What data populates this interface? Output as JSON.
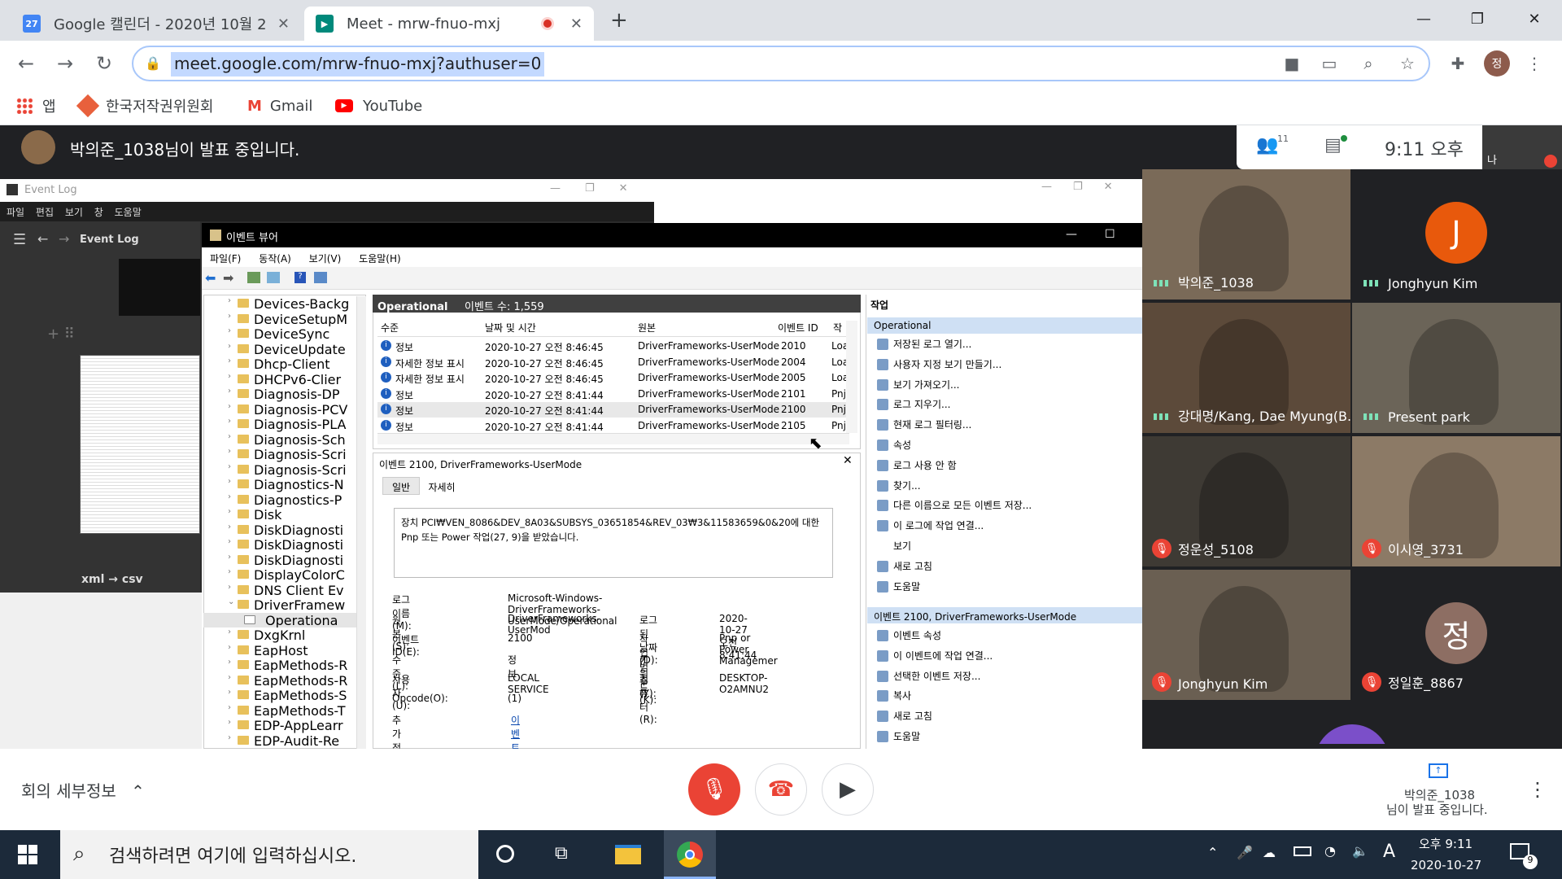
{
  "browser": {
    "tabs": [
      {
        "title": "Google 캘린더 - 2020년 10월 2",
        "icon_text": "27"
      },
      {
        "title": "Meet - mrw-fnuo-mxj"
      }
    ],
    "url": "meet.google.com/mrw-fnuo-mxj?authuser=0",
    "profile_initial": "정",
    "bookmarks": [
      {
        "label": "앱"
      },
      {
        "label": "한국저작권위원회"
      },
      {
        "label": "Gmail"
      },
      {
        "label": "YouTube"
      }
    ]
  },
  "meet": {
    "presenting_text": "박의준_1038님이 발표 중입니다.",
    "participant_count": "11",
    "time": "9:11 오후",
    "self_label": "나",
    "tiles": [
      {
        "name": "박의준_1038",
        "muted": false
      },
      {
        "name": "Jonghyun Kim",
        "muted": false,
        "initial": "J"
      },
      {
        "name": "강대명/Kang, Dae Myung(B...",
        "muted": false
      },
      {
        "name": "Present park",
        "muted": false
      },
      {
        "name": "정운성_5108",
        "muted": true
      },
      {
        "name": "이시영_3731",
        "muted": true
      },
      {
        "name": "Jonghyun Kim",
        "muted": true
      },
      {
        "name": "정일훈_8867",
        "muted": true,
        "initial": "정"
      }
    ],
    "meeting_details": "회의 세부정보",
    "presenter_box": {
      "line1": "박의준_1038",
      "line2": "님이 발표 중입니다."
    }
  },
  "eventlog_app": {
    "title": "Event Log",
    "menu": [
      "파일",
      "편집",
      "보기",
      "창",
      "도움말"
    ],
    "nav_title": "Event Log",
    "caption": "xml → csv"
  },
  "viewer": {
    "title": "이벤트 뷰어",
    "menu": [
      "파일(F)",
      "동작(A)",
      "보기(V)",
      "도움말(H)"
    ],
    "tree": [
      "Devices-Backg",
      "DeviceSetupM",
      "DeviceSync",
      "DeviceUpdate",
      "Dhcp-Client",
      "DHCPv6-Clier",
      "Diagnosis-DP",
      "Diagnosis-PCV",
      "Diagnosis-PLA",
      "Diagnosis-Sch",
      "Diagnosis-Scri",
      "Diagnosis-Scri",
      "Diagnostics-N",
      "Diagnostics-P",
      "Disk",
      "DiskDiagnosti",
      "DiskDiagnosti",
      "DiskDiagnosti",
      "DisplayColorC",
      "DNS Client Ev",
      "DriverFramew",
      "Operationa",
      "DxgKrnl",
      "EapHost",
      "EapMethods-R",
      "EapMethods-R",
      "EapMethods-S",
      "EapMethods-T",
      "EDP-AppLearr",
      "EDP-Audit-Re"
    ],
    "list_header": "Operational",
    "event_count": "이벤트 수: 1,559",
    "columns": [
      "수준",
      "날짜 및 시간",
      "원본",
      "이벤트 ID",
      "작"
    ],
    "rows": [
      {
        "level": "정보",
        "datetime": "2020-10-27 오전 8:46:45",
        "source": "DriverFrameworks-UserMode",
        "id": "2010",
        "task": "Loa"
      },
      {
        "level": "자세한 정보 표시",
        "datetime": "2020-10-27 오전 8:46:45",
        "source": "DriverFrameworks-UserMode",
        "id": "2004",
        "task": "Loa"
      },
      {
        "level": "자세한 정보 표시",
        "datetime": "2020-10-27 오전 8:46:45",
        "source": "DriverFrameworks-UserMode",
        "id": "2005",
        "task": "Loa"
      },
      {
        "level": "정보",
        "datetime": "2020-10-27 오전 8:41:44",
        "source": "DriverFrameworks-UserMode",
        "id": "2101",
        "task": "Pnj"
      },
      {
        "level": "정보",
        "datetime": "2020-10-27 오전 8:41:44",
        "source": "DriverFrameworks-UserMode",
        "id": "2100",
        "task": "Pnj"
      },
      {
        "level": "정보",
        "datetime": "2020-10-27 오전 8:41:44",
        "source": "DriverFrameworks-UserMode",
        "id": "2105",
        "task": "Pnj"
      }
    ],
    "detail": {
      "title": "이벤트 2100, DriverFrameworks-UserMode",
      "tabs": [
        "일반",
        "자세히"
      ],
      "message": "장치 PCI₩VEN_8086&DEV_8A03&SUBSYS_03651854&REV_03₩3&11583659&0&20에 대한 Pnp 또는 Power 작업(27, 9)을 받았습니다.",
      "fields": [
        {
          "label": "로그 이름(M):",
          "value": "Microsoft-Windows-DriverFrameworks-UserMode/Operational"
        },
        {
          "label": "원본(S):",
          "value": "DriverFrameworks-UserMod",
          "label2": "로그된 날짜(D):",
          "value2": "2020-10-27 오전 8:41:44"
        },
        {
          "label": "이벤트 ID(E):",
          "value": "2100",
          "label2": "작업 범주(Y):",
          "value2": "Pnp or Power Managemer"
        },
        {
          "label": "수준(L):",
          "value": "정보",
          "label2": "키워드(K):",
          "value2": ""
        },
        {
          "label": "사용자(U):",
          "value": "LOCAL SERVICE",
          "label2": "컴퓨터(R):",
          "value2": "DESKTOP-O2AMNU2"
        },
        {
          "label": "Opcode(O):",
          "value": "(1)"
        },
        {
          "label": "추가 정보(I):",
          "value": "이벤트 로그 도움말"
        }
      ]
    },
    "actions_header": "작업",
    "actions_group1": "Operational",
    "actions1": [
      "저장된 로그 열기...",
      "사용자 지정 보기 만들기...",
      "보기 가져오기...",
      "로그 지우기...",
      "현재 로그 필터링...",
      "속성",
      "로그 사용 안 함",
      "찾기...",
      "다른 이름으로 모든 이벤트 저장...",
      "이 로그에 작업 연결...",
      "보기",
      "새로 고침",
      "도움말"
    ],
    "actions_group2": "이벤트 2100, DriverFrameworks-UserMode",
    "actions2": [
      "이벤트 속성",
      "이 이벤트에 작업 연결...",
      "선택한 이벤트 저장...",
      "복사",
      "새로 고침",
      "도움말"
    ]
  },
  "taskbar": {
    "search_placeholder": "검색하려면 여기에 입력하십시오.",
    "ime": "A",
    "clock_time": "오후 9:11",
    "clock_date": "2020-10-27",
    "notification_count": "9"
  }
}
